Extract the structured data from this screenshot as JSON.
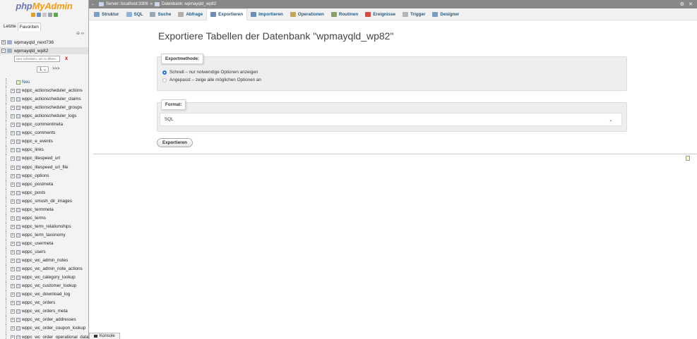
{
  "nav": {
    "logo_part1": "php",
    "logo_part2": "MyAdmin",
    "tabs": [
      "Letzte",
      "Favoriten"
    ],
    "collapse_label": "⊖ ∞",
    "databases": [
      {
        "name": "wpmayqld_next736",
        "expander": "+"
      },
      {
        "name": "wpmayqld_wp82",
        "expander": "−"
      }
    ],
    "filter_placeholder": "Hier schreiben, um zu filtern.",
    "filter_clear": "X",
    "pager_value": "1",
    "pager_next": ">>>",
    "new_label": "Neu",
    "tables": [
      "wppc_actionscheduler_actions",
      "wppc_actionscheduler_claims",
      "wppc_actionscheduler_groups",
      "wppc_actionscheduler_logs",
      "wppc_commentmeta",
      "wppc_comments",
      "wppc_e_events",
      "wppc_links",
      "wppc_litespeed_url",
      "wppc_litespeed_url_file",
      "wppc_options",
      "wppc_postmeta",
      "wppc_posts",
      "wppc_smush_dir_images",
      "wppc_termmeta",
      "wppc_terms",
      "wppc_term_relationships",
      "wppc_term_taxonomy",
      "wppc_usermeta",
      "wppc_users",
      "wppc_wc_admin_notes",
      "wppc_wc_admin_note_actions",
      "wppc_wc_category_lookup",
      "wppc_wc_customer_lookup",
      "wppc_wc_download_log",
      "wppc_wc_orders",
      "wppc_wc_orders_meta",
      "wppc_wc_order_addresses",
      "wppc_wc_order_coupon_lookup",
      "wppc_wc_order_operational_data"
    ]
  },
  "topbar": {
    "back_arrow": "←",
    "server": "Server: localhost:3306",
    "separator": "»",
    "database": "Datenbank: wpmayqld_wp82",
    "gear": "⚙",
    "close": "✕"
  },
  "tabs": [
    {
      "label": "Struktur",
      "icon": "structure-icon",
      "color": "#7aa0c8"
    },
    {
      "label": "SQL",
      "icon": "sql-icon",
      "color": "#8fb3d9"
    },
    {
      "label": "Suche",
      "icon": "search-icon",
      "color": "#9aa7b5"
    },
    {
      "label": "Abfrage",
      "icon": "query-icon",
      "color": "#b0b0b0"
    },
    {
      "label": "Exportieren",
      "icon": "export-icon",
      "color": "#6d8fb7",
      "active": true
    },
    {
      "label": "Importieren",
      "icon": "import-icon",
      "color": "#6d8fb7"
    },
    {
      "label": "Operationen",
      "icon": "wrench-icon",
      "color": "#c4a35a"
    },
    {
      "label": "Routinen",
      "icon": "routines-icon",
      "color": "#8aa06a"
    },
    {
      "label": "Ereignisse",
      "icon": "clock-icon",
      "color": "#d84a3a"
    },
    {
      "label": "Trigger",
      "icon": "trigger-icon",
      "color": "#b5b5b5"
    },
    {
      "label": "Designer",
      "icon": "designer-icon",
      "color": "#7c9cc0"
    }
  ],
  "main": {
    "title": "Exportiere Tabellen der Datenbank \"wpmayqld_wp82\"",
    "method_legend": "Exportmethode:",
    "method_quick": "Schnell – nur notwendige Optionen anzeigen",
    "method_custom": "Angepasst – zeige alle möglichen Optionen an",
    "format_legend": "Format:",
    "format_value": "SQL",
    "format_chevron": "⌄",
    "export_button": "Exportieren"
  },
  "console": {
    "label": "Konsole"
  }
}
